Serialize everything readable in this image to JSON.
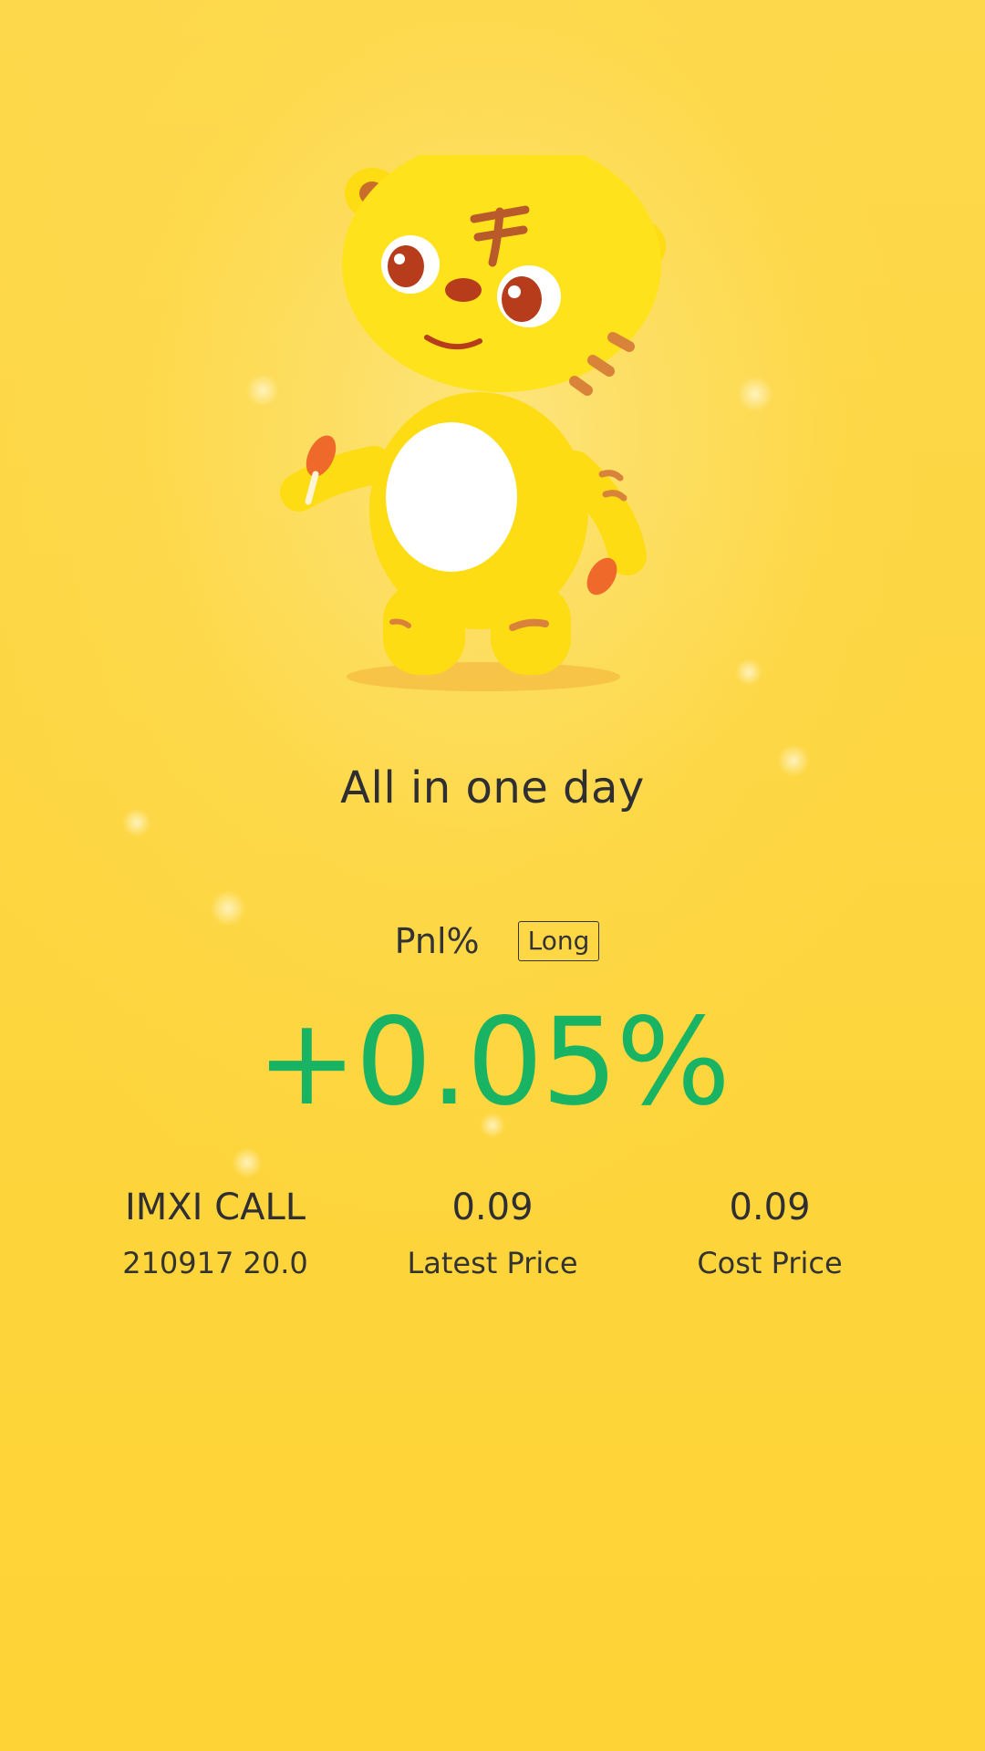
{
  "card": {
    "title": "All in one day"
  },
  "pnl": {
    "label": "Pnl%",
    "direction": "Long",
    "value": "+0.05%",
    "color": "#19b463"
  },
  "contract": {
    "name": "IMXI CALL",
    "detail": "210917 20.0"
  },
  "latest_price": {
    "value": "0.09",
    "label": "Latest Price"
  },
  "cost_price": {
    "value": "0.09",
    "label": "Cost Price"
  },
  "colors": {
    "background": "#fdd43a",
    "text": "#333333",
    "mascot": "#fde11a"
  },
  "icons": {
    "mascot": "tiger-mascot-illustration"
  }
}
